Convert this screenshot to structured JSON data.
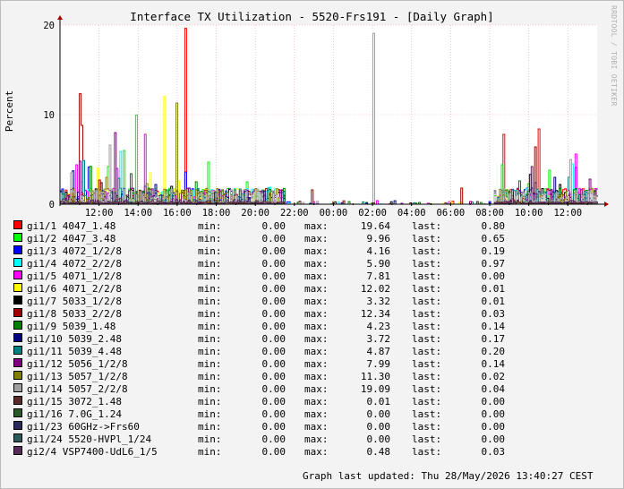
{
  "title": "Interface TX Utilization - 5520-Frs191 - [Daily Graph]",
  "watermark": "RRDTOOL / TOBI OETIKER",
  "updated": "Graph last updated: Thu 28/May/2026 13:40:27 CEST",
  "labels": {
    "min": "min:",
    "max": "max:",
    "last": "last:"
  },
  "chart_data": {
    "type": "line",
    "title": "Interface TX Utilization - 5520-Frs191 - [Daily Graph]",
    "ylabel": "Percent",
    "ylim": [
      0,
      20
    ],
    "yticks": [
      "0",
      "10",
      "20"
    ],
    "xticks": [
      "12:00",
      "14:00",
      "16:00",
      "18:00",
      "20:00",
      "22:00",
      "00:00",
      "02:00",
      "04:00",
      "06:00",
      "08:00",
      "10:00",
      "12:00"
    ],
    "xticks_hours": [
      12,
      14,
      16,
      18,
      20,
      22,
      24,
      26,
      28,
      30,
      32,
      34,
      36
    ],
    "xlim_hours": [
      10.0,
      37.5
    ],
    "grid": true,
    "series": [
      {
        "name": "gi1/1 4047_1.48",
        "color": "#FF0000",
        "min": "0.00",
        "max": "19.64",
        "last": "0.80",
        "peaks": [
          [
            16.35,
            19.64
          ],
          [
            15.75,
            1.5
          ],
          [
            32.7,
            7.8
          ],
          [
            34.5,
            8.4
          ],
          [
            17.1,
            1.2
          ]
        ]
      },
      {
        "name": "gi1/2 4047_3.48",
        "color": "#00FF00",
        "min": "0.00",
        "max": "9.96",
        "last": "0.65",
        "peaks": [
          [
            13.9,
            9.96
          ],
          [
            13.2,
            6.0
          ],
          [
            17.6,
            4.7
          ],
          [
            32.6,
            4.4
          ],
          [
            19.5,
            2.5
          ],
          [
            35.0,
            3.8
          ],
          [
            33.9,
            2.3
          ],
          [
            12.4,
            4.2
          ]
        ]
      },
      {
        "name": "gi1/3 4072_1/2/8",
        "color": "#0000FF",
        "min": "0.00",
        "max": "4.16",
        "last": "0.19",
        "peaks": [
          [
            16.4,
            3.6
          ],
          [
            11.4,
            4.16
          ],
          [
            14.3,
            2.0
          ],
          [
            36.4,
            4.1
          ],
          [
            34.3,
            2.4
          ]
        ]
      },
      {
        "name": "gi1/4 4072_2/2/8",
        "color": "#00FFFF",
        "min": "0.00",
        "max": "5.90",
        "last": "0.97",
        "peaks": [
          [
            13.1,
            5.9
          ],
          [
            20.7,
            1.9
          ],
          [
            36.2,
            4.5
          ],
          [
            11.1,
            2.5
          ],
          [
            15.2,
            1.4
          ]
        ]
      },
      {
        "name": "gi1/5 4071_1/2/8",
        "color": "#FF00FF",
        "min": "0.00",
        "max": "7.81",
        "last": "0.00",
        "peaks": [
          [
            14.3,
            7.81
          ],
          [
            36.4,
            5.6
          ],
          [
            26.2,
            0.4
          ],
          [
            10.8,
            4.4
          ],
          [
            12.9,
            4.0
          ]
        ]
      },
      {
        "name": "gi1/6 4071_2/2/8",
        "color": "#FFFF00",
        "min": "0.00",
        "max": "12.02",
        "last": "0.01",
        "peaks": [
          [
            15.3,
            12.02
          ],
          [
            14.6,
            3.5
          ],
          [
            11.9,
            4.0
          ],
          [
            16.0,
            2.6
          ]
        ]
      },
      {
        "name": "gi1/7 5033_1/2/8",
        "color": "#000000",
        "min": "0.00",
        "max": "3.32",
        "last": "0.01",
        "peaks": [
          [
            34.0,
            3.32
          ],
          [
            15.7,
            2.0
          ],
          [
            12.1,
            2.4
          ],
          [
            35.6,
            2.2
          ]
        ]
      },
      {
        "name": "gi1/8 5033_2/2/8",
        "color": "#A00000",
        "min": "0.00",
        "max": "12.34",
        "last": "0.03",
        "peaks": [
          [
            10.95,
            12.34
          ],
          [
            11.1,
            8.8
          ],
          [
            12.0,
            2.7
          ],
          [
            34.3,
            6.4
          ],
          [
            22.9,
            1.6
          ],
          [
            30.5,
            1.8
          ]
        ]
      },
      {
        "name": "gi1/9 5039_1.48",
        "color": "#008000",
        "min": "0.00",
        "max": "4.23",
        "last": "0.14",
        "peaks": [
          [
            11.5,
            4.23
          ],
          [
            13.6,
            3.4
          ],
          [
            16.9,
            2.5
          ],
          [
            33.5,
            2.6
          ],
          [
            18.3,
            1.5
          ]
        ]
      },
      {
        "name": "gi1/10 5039_2.48",
        "color": "#000080",
        "min": "0.00",
        "max": "3.72",
        "last": "0.17",
        "peaks": [
          [
            10.6,
            3.72
          ],
          [
            14.9,
            2.2
          ],
          [
            35.3,
            3.0
          ],
          [
            16.6,
            1.8
          ]
        ]
      },
      {
        "name": "gi1/11 5039_4.48",
        "color": "#008080",
        "min": "0.00",
        "max": "4.87",
        "last": "0.20",
        "peaks": [
          [
            11.2,
            4.87
          ],
          [
            13.0,
            2.9
          ],
          [
            36.0,
            3.0
          ],
          [
            20.6,
            1.8
          ]
        ]
      },
      {
        "name": "gi1/12 5056_1/2/8",
        "color": "#800080",
        "min": "0.00",
        "max": "7.99",
        "last": "0.14",
        "peaks": [
          [
            12.8,
            7.99
          ],
          [
            11.0,
            4.8
          ],
          [
            34.1,
            4.2
          ],
          [
            37.1,
            2.8
          ]
        ]
      },
      {
        "name": "gi1/13 5057_1/2/8",
        "color": "#808000",
        "min": "0.00",
        "max": "11.30",
        "last": "0.02",
        "peaks": [
          [
            15.9,
            11.3
          ],
          [
            14.4,
            2.3
          ],
          [
            12.3,
            3.0
          ]
        ]
      },
      {
        "name": "gi1/14 5057_2/2/8",
        "color": "#A0A0A0",
        "min": "0.00",
        "max": "19.09",
        "last": "0.04",
        "peaks": [
          [
            26.05,
            19.09
          ],
          [
            12.5,
            6.6
          ],
          [
            10.5,
            3.5
          ],
          [
            19.8,
            1.2
          ],
          [
            36.1,
            5.0
          ]
        ]
      },
      {
        "name": "gi1/15 3072_1.48",
        "color": "#5A2A2A",
        "min": "0.00",
        "max": "0.01",
        "last": "0.00",
        "peaks": []
      },
      {
        "name": "gi1/16 7.0G_1.24",
        "color": "#2A5A2A",
        "min": "0.00",
        "max": "0.00",
        "last": "0.00",
        "peaks": []
      },
      {
        "name": "gi1/23 60GHz->Frs60",
        "color": "#2A2A5A",
        "min": "0.00",
        "max": "0.00",
        "last": "0.00",
        "peaks": []
      },
      {
        "name": "gi1/24 5520-HVPl_1/24",
        "color": "#2A5A5A",
        "min": "0.00",
        "max": "0.00",
        "last": "0.00",
        "peaks": []
      },
      {
        "name": "gi2/4 VSP7400-UdL6_1/5",
        "color": "#5A2A5A",
        "min": "0.00",
        "max": "0.48",
        "last": "0.03",
        "peaks": [
          [
            11.6,
            0.48
          ],
          [
            33.0,
            0.4
          ]
        ]
      }
    ]
  }
}
